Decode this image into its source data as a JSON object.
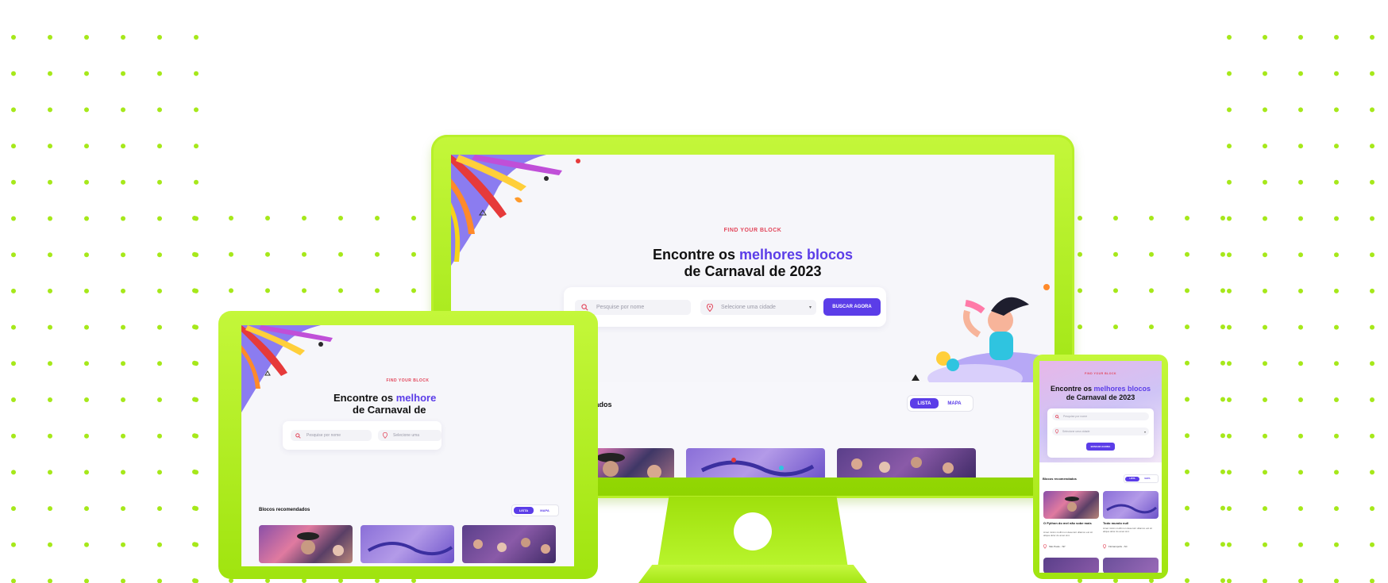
{
  "hero": {
    "eyebrow": "FIND YOUR BLOCK",
    "headline_pre": "Encontre os ",
    "headline_accent": "melhores blocos",
    "headline_line2": "de Carnaval de 2023"
  },
  "laptop_hero": {
    "headline_pre": "Encontre os ",
    "headline_accent": "melhore",
    "headline_line2": "de Carnaval de "
  },
  "search": {
    "name_placeholder": "Pesquise por nome",
    "city_placeholder": "Selecione uma cidade",
    "city_placeholder_cut": "Selecione uma",
    "submit_label": "BUSCAR AGORA"
  },
  "recommended": {
    "title": "Blocos recomendados",
    "view_list": "LISTA",
    "view_map": "MAPA"
  },
  "tablet_cards": [
    {
      "title": "O Python do mel não sobe mais",
      "desc": "Amet minim mollit non deserunt ullamco est sit aliqua dolor do amet sint.",
      "location": "São Paulo - SP"
    },
    {
      "title": "Todo mundo null",
      "desc": "Amet minim mollit non deserunt ullamco est sit aliqua dolor do amet sint.",
      "location": "Florianópolis - SC"
    }
  ],
  "colors": {
    "accent": "#5b3de8",
    "eyebrow": "#e2455a",
    "device_green": "#a6e81a",
    "dot_green": "#a6e81a"
  },
  "icons": {
    "search": "search-icon",
    "location": "map-pin-icon",
    "dropdown": "chevron-down-icon"
  }
}
